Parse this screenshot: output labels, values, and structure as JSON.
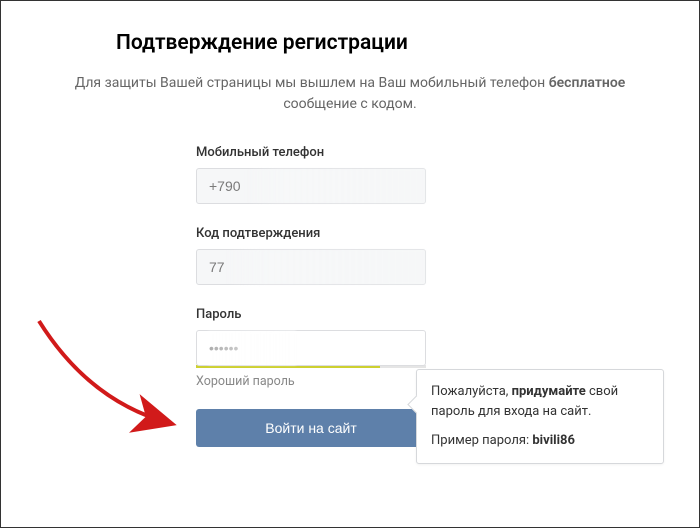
{
  "title": "Подтверждение регистрации",
  "subtitle_pre": "Для защиты Вашей страницы мы вышлем на Ваш мобильный телефон ",
  "subtitle_bold": "бесплатное",
  "subtitle_post": " сообщение с кодом.",
  "fields": {
    "phone": {
      "label": "Мобильный телефон",
      "value": "+790"
    },
    "code": {
      "label": "Код подтверждения",
      "value": "77"
    },
    "password": {
      "label": "Пароль",
      "value": "••••••",
      "strength_text": "Хороший пароль"
    }
  },
  "tooltip": {
    "line1_pre": "Пожалуйста, ",
    "line1_bold": "придумайте",
    "line1_post": " свой пароль для входа на сайт.",
    "line2_pre": "Пример пароля: ",
    "line2_bold": "bivili86"
  },
  "submit_label": "Войти на сайт"
}
